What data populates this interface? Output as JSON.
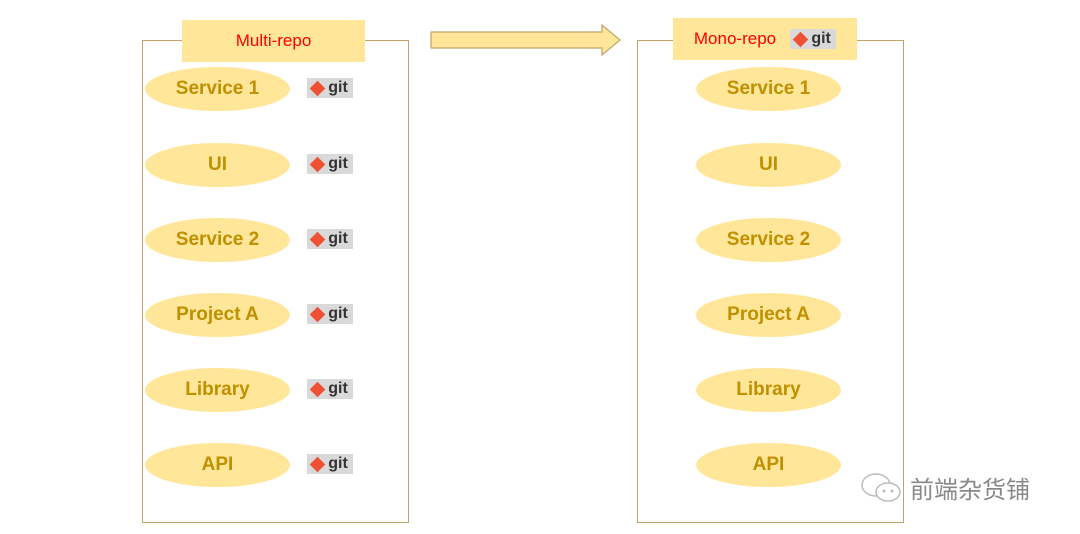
{
  "left": {
    "title": "Multi-repo",
    "items": [
      "Service 1",
      "UI",
      "Service 2",
      "Project A",
      "Library",
      "API"
    ]
  },
  "right": {
    "title": "Mono-repo",
    "items": [
      "Service 1",
      "UI",
      "Service 2",
      "Project A",
      "Library",
      "API"
    ]
  },
  "git_label": "git",
  "watermark": "前端杂货铺",
  "colors": {
    "ellipse": "#ffe699",
    "text": "#bf9000",
    "title": "#ff0000",
    "git": "#f05033"
  }
}
